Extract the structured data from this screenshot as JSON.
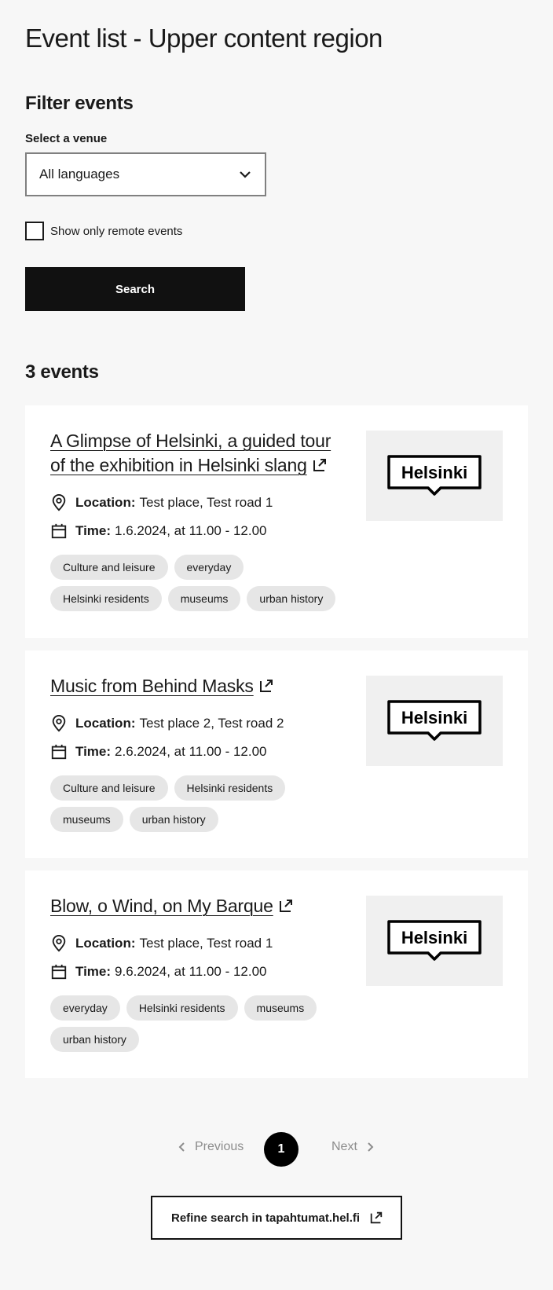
{
  "page": {
    "title": "Event list - Upper content region"
  },
  "filters": {
    "heading": "Filter events",
    "venue_label": "Select a venue",
    "venue_value": "All languages",
    "remote_label": "Show only remote events",
    "search_label": "Search"
  },
  "events_count": "3 events",
  "events": [
    {
      "title": "A Glimpse of Helsinki, a guided tour of the exhibition in Helsinki slang",
      "location_label": "Location:",
      "location": "Test place, Test road 1",
      "time_label": "Time:",
      "time": "1.6.2024, at 11.00 - 12.00",
      "tags": [
        "Culture and leisure",
        "everyday",
        "Helsinki residents",
        "museums",
        "urban history"
      ],
      "image_text": "Helsinki"
    },
    {
      "title": "Music from Behind Masks",
      "location_label": "Location:",
      "location": "Test place 2, Test road 2",
      "time_label": "Time:",
      "time": "2.6.2024, at 11.00 - 12.00",
      "tags": [
        "Culture and leisure",
        "Helsinki residents",
        "museums",
        "urban history"
      ],
      "image_text": "Helsinki"
    },
    {
      "title": "Blow, o Wind, on My Barque",
      "location_label": "Location:",
      "location": "Test place, Test road 1",
      "time_label": "Time:",
      "time": "9.6.2024, at 11.00 - 12.00",
      "tags": [
        "everyday",
        "Helsinki residents",
        "museums",
        "urban history"
      ],
      "image_text": "Helsinki"
    }
  ],
  "pagination": {
    "previous": "Previous",
    "current": "1",
    "next": "Next"
  },
  "refine": {
    "label": "Refine search in tapahtumat.hel.fi"
  },
  "colors": {
    "background": "#f7f7f7",
    "button": "#111111",
    "tag": "#e6e6e6",
    "image_bg": "#f0f0f0"
  }
}
